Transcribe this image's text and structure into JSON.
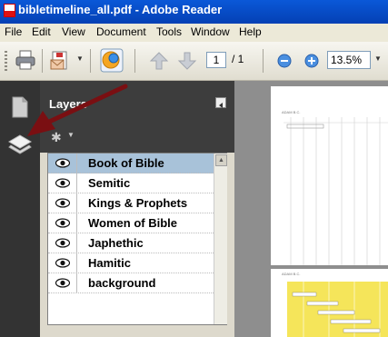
{
  "window": {
    "title": "bibletimeline_all.pdf - Adobe Reader",
    "app_icon": "pdf-document-icon"
  },
  "menu": [
    "File",
    "Edit",
    "View",
    "Document",
    "Tools",
    "Window",
    "Help"
  ],
  "toolbar": {
    "icons": [
      "printer-icon",
      "email-icon",
      "dropdown-caret-icon",
      "hand-tool-icon",
      "page-up-icon",
      "page-down-icon",
      "zoom-out-icon",
      "zoom-in-icon",
      "zoom-dropdown-icon"
    ],
    "page_current": "1",
    "page_total": "/ 1",
    "zoom": "13.5%"
  },
  "nav_pane": {
    "icons": [
      "pages-icon",
      "layers-icon"
    ]
  },
  "layers_panel": {
    "title": "Layers",
    "options_icon": "gear-icon",
    "layers": [
      {
        "name": "Book of Bible",
        "visible": true,
        "selected": true
      },
      {
        "name": "Semitic",
        "visible": true,
        "selected": false
      },
      {
        "name": "Kings & Prophets",
        "visible": true,
        "selected": false
      },
      {
        "name": "Women of Bible",
        "visible": true,
        "selected": false
      },
      {
        "name": "Japhethic",
        "visible": true,
        "selected": false
      },
      {
        "name": "Hamitic",
        "visible": true,
        "selected": false
      },
      {
        "name": "background",
        "visible": true,
        "selected": false
      }
    ]
  },
  "document": {
    "page1_header": "ADAM B.C.",
    "page2_header": "ADAM B.C."
  },
  "colors": {
    "title_bar": "#0a58d8",
    "selected_row": "#a8c2d9",
    "annotation_arrow": "#7a0f12",
    "page_highlight": "#f5e55a"
  }
}
